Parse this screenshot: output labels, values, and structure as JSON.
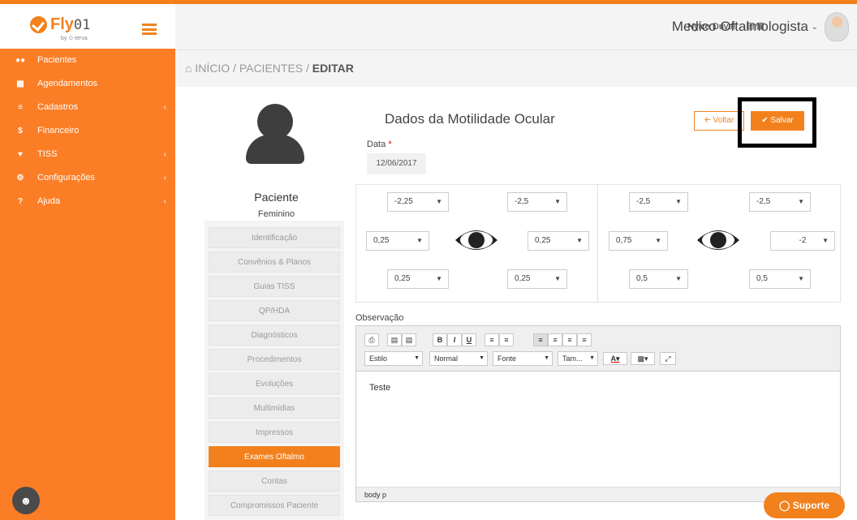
{
  "brand": {
    "name": "Fly",
    "suffix": "01",
    "byline": "by ⊙ terva"
  },
  "topbar": {
    "user": "Nylce Duval",
    "role": "Medico Oftalmologista"
  },
  "sidebar": {
    "items": [
      {
        "label": "Pacientes",
        "icon": "users-icon",
        "has_children": false
      },
      {
        "label": "Agendamentos",
        "icon": "calendar-icon",
        "has_children": false
      },
      {
        "label": "Cadastros",
        "icon": "list-icon",
        "has_children": true
      },
      {
        "label": "Financeiro",
        "icon": "dollar-icon",
        "has_children": false
      },
      {
        "label": "TISS",
        "icon": "handshake-icon",
        "has_children": true
      },
      {
        "label": "Configurações",
        "icon": "gear-icon",
        "has_children": true
      },
      {
        "label": "Ajuda",
        "icon": "question-icon",
        "has_children": true
      }
    ]
  },
  "breadcrumb": {
    "home": "INÍCIO",
    "sep1": "/",
    "section": "PACIENTES",
    "sep2": "/",
    "current": "EDITAR"
  },
  "patient": {
    "label": "Paciente",
    "sex": "Feminino"
  },
  "patient_menu": [
    {
      "label": "Identificação",
      "active": false
    },
    {
      "label": "Convênios & Planos",
      "active": false
    },
    {
      "label": "Guias TISS",
      "active": false
    },
    {
      "label": "QP/HDA",
      "active": false
    },
    {
      "label": "Diagnósticos",
      "active": false
    },
    {
      "label": "Procedimentos",
      "active": false
    },
    {
      "label": "Evoluções",
      "active": false
    },
    {
      "label": "Multimídias",
      "active": false
    },
    {
      "label": "Impressos",
      "active": false
    },
    {
      "label": "Exames Oftalmo",
      "active": true
    },
    {
      "label": "Contas",
      "active": false
    },
    {
      "label": "Compromissos Paciente",
      "active": false
    }
  ],
  "form": {
    "title": "Dados da Motilidade Ocular",
    "voltar": "Voltar",
    "salvar": "Salvar",
    "data_label": "Data",
    "required_mark": "*",
    "date": "12/06/2017"
  },
  "motility": {
    "right_eye": {
      "top_left": "-2,25",
      "top_right": "-2,5",
      "mid_left": "0,25",
      "mid_right": "0,25",
      "bottom_left": "0,25",
      "bottom_right": "0,25"
    },
    "left_eye": {
      "top_left": "-2,5",
      "top_right": "-2,5",
      "mid_left": "0,75",
      "mid_right": "-2",
      "bottom_left": "0,5",
      "bottom_right": "0,5"
    }
  },
  "observation": {
    "label": "Observação",
    "text": "Teste",
    "statusbar": "body  p",
    "toolbar": {
      "estilo": "Estilo",
      "normal": "Normal",
      "fonte": "Fonte",
      "tam": "Tam..."
    }
  },
  "suporte": "Suporte",
  "colors": {
    "accent": "#f2811d",
    "sidebar": "#fb7d25"
  }
}
